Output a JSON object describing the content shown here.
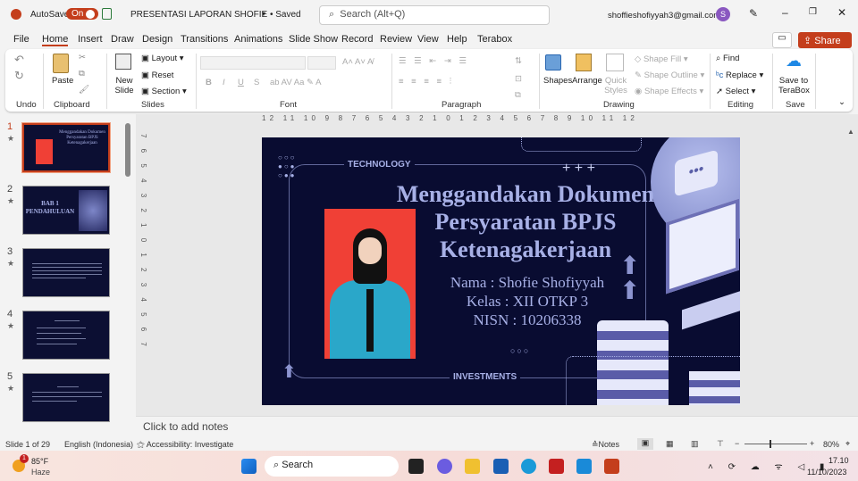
{
  "titlebar": {
    "autosave_label": "AutoSave",
    "autosave_state": "On",
    "doc_title": "PRESENTASI LAPORAN SHOFIE • Saved",
    "search_placeholder": "Search (Alt+Q)",
    "account_email": "shoffieshofiyyah3@gmail.com",
    "avatar_letter": "S"
  },
  "tabs": [
    "File",
    "Home",
    "Insert",
    "Draw",
    "Design",
    "Transitions",
    "Animations",
    "Slide Show",
    "Record",
    "Review",
    "View",
    "Help",
    "Terabox"
  ],
  "share_label": "Share",
  "ribbon": {
    "groups": {
      "undo": "Undo",
      "clipboard": "Clipboard",
      "slides": "Slides",
      "font": "Font",
      "paragraph": "Paragraph",
      "drawing": "Drawing",
      "editing": "Editing",
      "save": "Save"
    },
    "paste": "Paste",
    "new_slide": "New Slide",
    "layout": "Layout",
    "reset": "Reset",
    "section": "Section",
    "shapes": "Shapes",
    "arrange": "Arrange",
    "quick_styles": "Quick Styles",
    "shape_fill": "Shape Fill",
    "shape_outline": "Shape Outline",
    "shape_effects": "Shape Effects",
    "find": "Find",
    "replace": "Replace",
    "select": "Select",
    "save_terabox": "Save to TeraBox",
    "font_buttons": [
      "B",
      "I",
      "U",
      "S"
    ]
  },
  "thumbnails": [
    {
      "num": "1",
      "title": "Menggandakan Dokumen Persyaratan BPJS Ketenagakerjaan"
    },
    {
      "num": "2",
      "title": "BAB 1 PENDAHULUAN"
    },
    {
      "num": "3",
      "title": ""
    },
    {
      "num": "4",
      "title": ""
    },
    {
      "num": "5",
      "title": ""
    }
  ],
  "slide": {
    "tag_top": "TECHNOLOGY",
    "tag_bottom": "INVESTMENTS",
    "title_lines": [
      "Menggandakan Dokumen",
      "Persyaratan BPJS",
      "Ketenagakerjaan"
    ],
    "info_lines": [
      "Nama : Shofie Shofiyyah",
      "Kelas  : XII OTKP 3",
      "NISN  : 10206338"
    ],
    "plus_marks": "+ + +"
  },
  "ruler_h": "12 11 10 9 8 7 6 5 4 3 2 1 0 1 2 3 4 5 6 7 8 9 10 11 12",
  "ruler_v": "7 6 5 4 3 2 1 0 1 2 3 4 5 6 7",
  "notes_placeholder": "Click to add notes",
  "status": {
    "slide_info": "Slide 1 of 29",
    "language": "English (Indonesia)",
    "accessibility": "Accessibility: Investigate",
    "notes": "Notes",
    "zoom": "80%",
    "zoom_fraction": 0.4
  },
  "taskbar": {
    "weather_temp": "85°F",
    "weather_desc": "Haze",
    "weather_badge": "1",
    "search": "Search",
    "time": "17.10",
    "date": "11/10/2023"
  },
  "colors": {
    "accent": "#c43e1c",
    "slide_bg": "#090c31",
    "slide_text": "#a7b0e6"
  }
}
